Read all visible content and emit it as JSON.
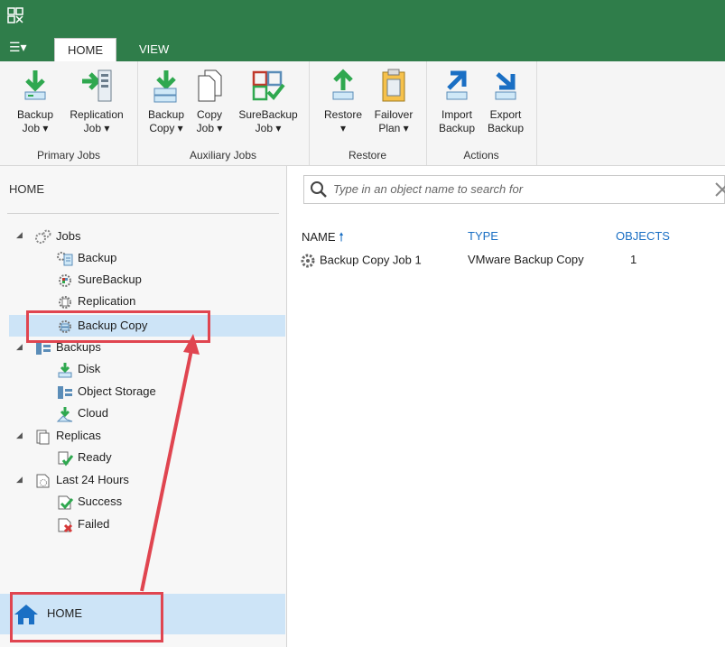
{
  "tabs": {
    "menu": "☰▾",
    "home": "HOME",
    "view": "VIEW"
  },
  "ribbon": {
    "groups": {
      "primary": "Primary Jobs",
      "auxiliary": "Auxiliary Jobs",
      "restore": "Restore",
      "actions": "Actions"
    },
    "buttons": {
      "backup_job": [
        "Backup",
        "Job ▾"
      ],
      "replication_job": [
        "Replication",
        "Job ▾"
      ],
      "backup_copy": [
        "Backup",
        "Copy ▾"
      ],
      "copy_job": [
        "Copy",
        "Job ▾"
      ],
      "surebackup_job": [
        "SureBackup",
        "Job ▾"
      ],
      "restore": [
        "Restore",
        "▾"
      ],
      "failover_plan": [
        "Failover",
        "Plan ▾"
      ],
      "import_backup": [
        "Import",
        "Backup"
      ],
      "export_backup": [
        "Export",
        "Backup"
      ]
    }
  },
  "sidebar": {
    "title": "HOME",
    "tree": {
      "jobs": "Jobs",
      "backup": "Backup",
      "surebackup": "SureBackup",
      "replication": "Replication",
      "backup_copy": "Backup Copy",
      "backups": "Backups",
      "disk": "Disk",
      "object_storage": "Object Storage",
      "cloud": "Cloud",
      "replicas": "Replicas",
      "ready": "Ready",
      "last24": "Last 24 Hours",
      "success": "Success",
      "failed": "Failed"
    },
    "nav_home": "HOME"
  },
  "search": {
    "placeholder": "Type in an object name to search for"
  },
  "table": {
    "headers": {
      "name": "NAME",
      "type": "TYPE",
      "objects": "OBJECTS"
    },
    "rows": [
      {
        "name": "Backup Copy Job 1",
        "type": "VMware Backup Copy",
        "objects": "1"
      }
    ]
  },
  "colors": {
    "brand": "#2f7d4a",
    "selected": "#cde4f7",
    "annotation": "#e04550",
    "link": "#1a6fc4"
  }
}
